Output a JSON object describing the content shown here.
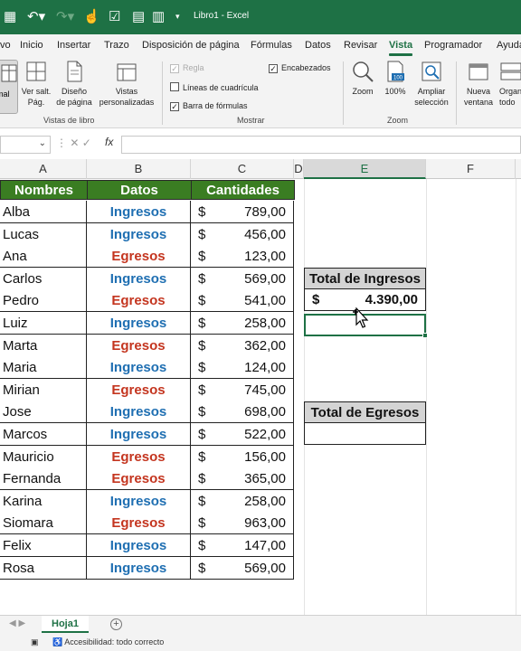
{
  "window": {
    "title": "Libro1 - Excel"
  },
  "ribbon_tabs": [
    "vo",
    "Inicio",
    "Insertar",
    "Trazo",
    "Disposición de página",
    "Fórmulas",
    "Datos",
    "Revisar",
    "Vista",
    "Programador",
    "Ayuda"
  ],
  "ribbon": {
    "normal": "rmal",
    "page_break": "Ver salt.\nPág.",
    "page_layout": "Diseño\nde página",
    "custom_views": "Vistas\npersonalizadas",
    "group_views": "Vistas de libro",
    "ruler": "Regla",
    "gridlines": "Líneas de cuadrícula",
    "formula_bar": "Barra de fórmulas",
    "headings": "Encabezados",
    "group_show": "Mostrar",
    "zoom": "Zoom",
    "zoom100": "100%",
    "zoom_selection": "Ampliar\nselección",
    "group_zoom": "Zoom",
    "new_window": "Nueva\nventana",
    "arrange_all": "Organ\ntodo"
  },
  "columns": [
    "A",
    "B",
    "C",
    "D",
    "E",
    "F"
  ],
  "table": {
    "headers": [
      "Nombres",
      "Datos",
      "Cantidades"
    ],
    "rows": [
      {
        "name": "Alba",
        "type": "Ingresos",
        "cur": "$",
        "amount": "789,00"
      },
      {
        "name": "Lucas",
        "type": "Ingresos",
        "cur": "$",
        "amount": "456,00"
      },
      {
        "name": "Ana",
        "type": "Egresos",
        "cur": "$",
        "amount": "123,00"
      },
      {
        "name": "Carlos",
        "type": "Ingresos",
        "cur": "$",
        "amount": "569,00"
      },
      {
        "name": "Pedro",
        "type": "Egresos",
        "cur": "$",
        "amount": "541,00"
      },
      {
        "name": "Luiz",
        "type": "Ingresos",
        "cur": "$",
        "amount": "258,00"
      },
      {
        "name": "Marta",
        "type": "Egresos",
        "cur": "$",
        "amount": "362,00"
      },
      {
        "name": "Maria",
        "type": "Ingresos",
        "cur": "$",
        "amount": "124,00"
      },
      {
        "name": "Mirian",
        "type": "Egresos",
        "cur": "$",
        "amount": "745,00"
      },
      {
        "name": "Jose",
        "type": "Ingresos",
        "cur": "$",
        "amount": "698,00"
      },
      {
        "name": "Marcos",
        "type": "Ingresos",
        "cur": "$",
        "amount": "522,00"
      },
      {
        "name": "Mauricio",
        "type": "Egresos",
        "cur": "$",
        "amount": "156,00"
      },
      {
        "name": "Fernanda",
        "type": "Egresos",
        "cur": "$",
        "amount": "365,00"
      },
      {
        "name": "Karina",
        "type": "Ingresos",
        "cur": "$",
        "amount": "258,00"
      },
      {
        "name": "Siomara",
        "type": "Egresos",
        "cur": "$",
        "amount": "963,00"
      },
      {
        "name": "Felix",
        "type": "Ingresos",
        "cur": "$",
        "amount": "147,00"
      },
      {
        "name": "Rosa",
        "type": "Ingresos",
        "cur": "$",
        "amount": "569,00"
      }
    ]
  },
  "summary": {
    "ingresos_label": "Total de Ingresos",
    "ingresos_cur": "$",
    "ingresos_value": "4.390,00",
    "egresos_label": "Total de Egresos",
    "egresos_value": ""
  },
  "sheet_tab": "Hoja1",
  "status": {
    "accessibility": "Accesibilidad: todo correcto"
  },
  "colors": {
    "excel_green": "#1e7145",
    "header_green": "#3a7d22",
    "ingresos_blue": "#1f6fb2",
    "egresos_red": "#c4351f"
  }
}
